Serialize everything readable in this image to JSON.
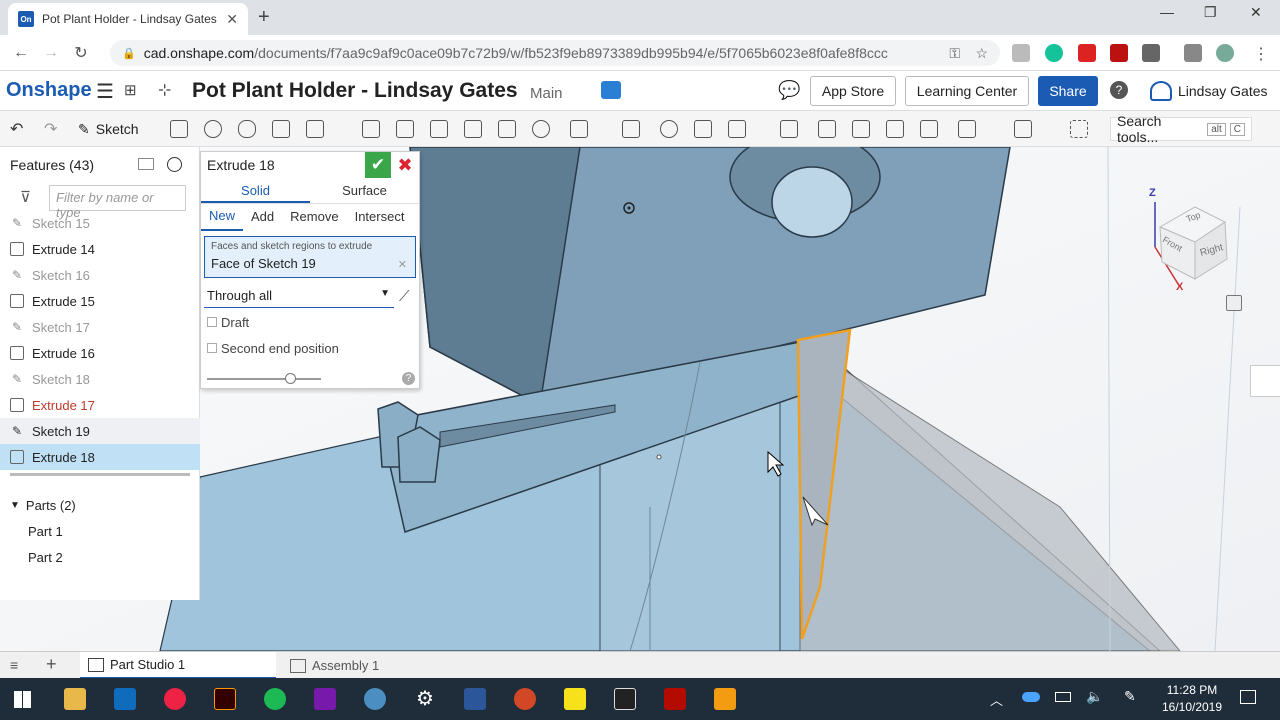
{
  "browser": {
    "tab_title": "Pot Plant Holder - Lindsay Gates",
    "favicon_text": "On",
    "url_host": "cad.onshape.com",
    "url_path": "/documents/f7aa9c9af9c0ace09b7c72b9/w/fb523f9eb8973389db995b94/e/5f7065b6023e8f0afe8f8ccc"
  },
  "header": {
    "logo": "Onshape",
    "doc_title": "Pot Plant Holder - Lindsay Gates",
    "branch": "Main",
    "app_store": "App Store",
    "learning_center": "Learning Center",
    "share": "Share",
    "user": "Lindsay Gates"
  },
  "toolbar": {
    "sketch": "Sketch",
    "search_placeholder": "Search tools...",
    "kbd_alt": "alt",
    "kbd_c": "C"
  },
  "features": {
    "header": "Features (43)",
    "filter_placeholder": "Filter by name or type",
    "items": [
      {
        "label": "Sketch 15",
        "kind": "sketch"
      },
      {
        "label": "Extrude 14",
        "kind": "extrude"
      },
      {
        "label": "Sketch 16",
        "kind": "sketch"
      },
      {
        "label": "Extrude 15",
        "kind": "extrude"
      },
      {
        "label": "Sketch 17",
        "kind": "sketch"
      },
      {
        "label": "Extrude 16",
        "kind": "extrude"
      },
      {
        "label": "Sketch 18",
        "kind": "sketch"
      },
      {
        "label": "Extrude 17",
        "kind": "error"
      },
      {
        "label": "Sketch 19",
        "kind": "active-sketch"
      },
      {
        "label": "Extrude 18",
        "kind": "selected"
      }
    ],
    "parts_header": "Parts (2)",
    "parts": [
      "Part 1",
      "Part 2"
    ]
  },
  "dialog": {
    "title": "Extrude 18",
    "tab_solid": "Solid",
    "tab_surface": "Surface",
    "op_new": "New",
    "op_add": "Add",
    "op_remove": "Remove",
    "op_intersect": "Intersect",
    "faces_label": "Faces and sketch regions to extrude",
    "faces_value": "Face of Sketch 19",
    "end_type": "Through all",
    "draft": "Draft",
    "second_end": "Second end position"
  },
  "viewcube": {
    "top": "Top",
    "front": "Front",
    "right": "Right",
    "axis_z": "Z",
    "axis_x": "X"
  },
  "bottom_tabs": {
    "part_studio": "Part Studio 1",
    "assembly": "Assembly 1"
  },
  "taskbar": {
    "time": "11:28 PM",
    "date": "16/10/2019"
  },
  "colors": {
    "accent": "#1b5bb3",
    "model_blue": "#9fc4dc",
    "selection_orange": "#f0a020",
    "error_red": "#c0392b"
  }
}
